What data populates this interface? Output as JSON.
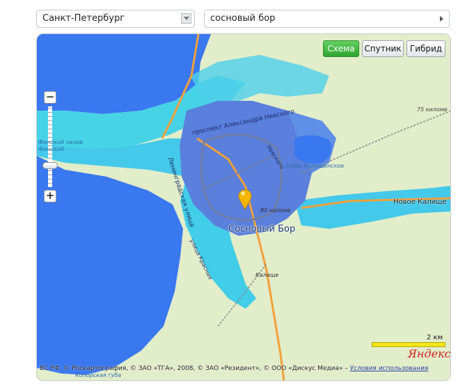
{
  "controls": {
    "city_value": "Санкт-Петербург",
    "search_value": "сосновый бор"
  },
  "map_types": {
    "scheme": "Схема",
    "satellite": "Спутник",
    "hybrid": "Гибрид",
    "active": "scheme"
  },
  "zoom": {
    "in": "+",
    "out": "−"
  },
  "labels": {
    "town": "Сосновый Бор",
    "novoe": "Новое Калище",
    "km75": "75 киломе",
    "lake": "озеро Калищенское",
    "km80": "80 киломе",
    "bay1": "Финский залив",
    "bay2": "Финский",
    "kalishche": "Калище",
    "koporye": "Копорская губа",
    "alex": "проспект Александра Невского",
    "lenin": "Ленинградская улица",
    "kr": "улица Красных",
    "nev": "Невского"
  },
  "scale": {
    "label": "2 км"
  },
  "logo": "Яндекс",
  "copyright": {
    "text": "ВС РФ, © Роскартография, © ЗАО «ТГА», 2008, © ЗАО «Резидент», © ООО «Дискус Медиа» – ",
    "link": "Условия использования"
  },
  "colors": {
    "sea": "#3a78f0",
    "flood_light": "#40d6e8",
    "flood_mid": "#4fa8f5",
    "land": "#e2edca",
    "town": "#5a7fdc",
    "road": "#f2a03a",
    "scheme_active": "#3cb43c"
  },
  "icons": {
    "marker": "yellow-map-pin"
  }
}
